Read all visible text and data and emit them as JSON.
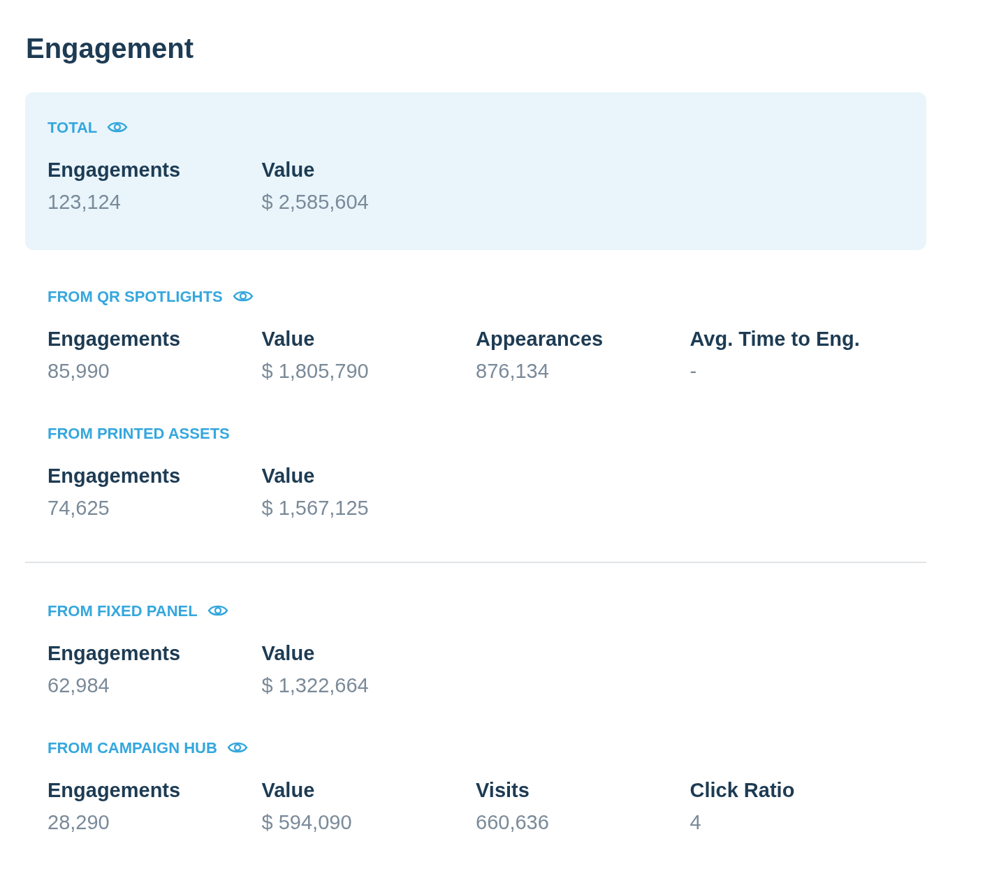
{
  "title": "Engagement",
  "groups": [
    {
      "kind": "card",
      "sections": [
        {
          "label": "TOTAL",
          "eye_icon": true,
          "metrics": [
            {
              "label": "Engagements",
              "value": "123,124"
            },
            {
              "label": "Value",
              "value": "$ 2,585,604"
            }
          ]
        }
      ]
    },
    {
      "kind": "plain",
      "sections": [
        {
          "label": "FROM QR SPOTLIGHTS",
          "eye_icon": true,
          "metrics": [
            {
              "label": "Engagements",
              "value": "85,990"
            },
            {
              "label": "Value",
              "value": "$ 1,805,790"
            },
            {
              "label": "Appearances",
              "value": "876,134"
            },
            {
              "label": "Avg. Time to Eng.",
              "value": "-"
            }
          ]
        },
        {
          "label": "FROM PRINTED ASSETS",
          "eye_icon": false,
          "metrics": [
            {
              "label": "Engagements",
              "value": "74,625"
            },
            {
              "label": "Value",
              "value": "$ 1,567,125"
            }
          ]
        }
      ]
    },
    {
      "kind": "plain",
      "sections": [
        {
          "label": "FROM FIXED PANEL",
          "eye_icon": true,
          "metrics": [
            {
              "label": "Engagements",
              "value": "62,984"
            },
            {
              "label": "Value",
              "value": "$ 1,322,664"
            }
          ]
        },
        {
          "label": "FROM CAMPAIGN HUB",
          "eye_icon": true,
          "metrics": [
            {
              "label": "Engagements",
              "value": "28,290"
            },
            {
              "label": "Value",
              "value": "$ 594,090"
            },
            {
              "label": "Visits",
              "value": "660,636"
            },
            {
              "label": "Click Ratio",
              "value": "4"
            }
          ]
        }
      ]
    }
  ]
}
